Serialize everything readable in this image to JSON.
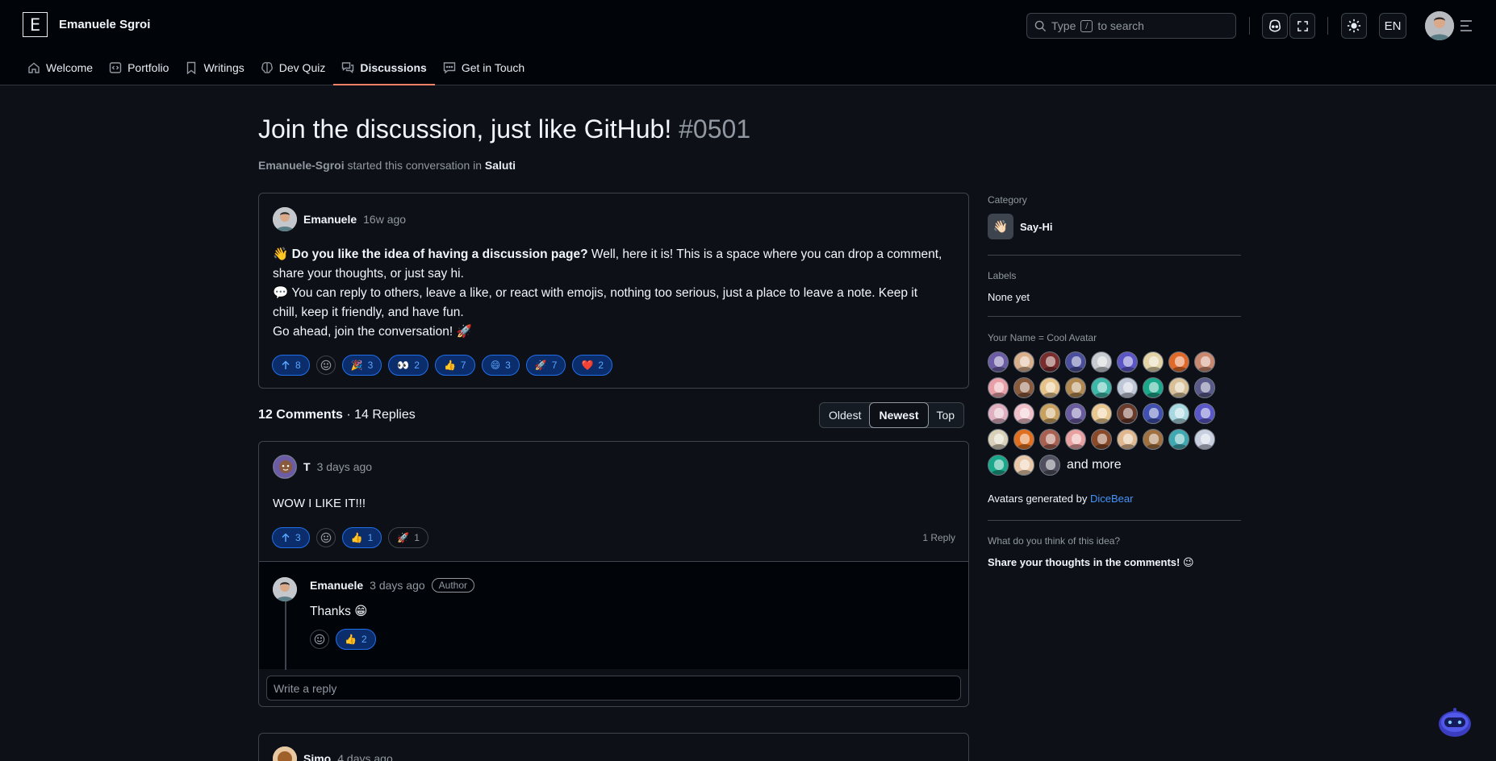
{
  "header": {
    "logo_letter": "E",
    "brand": "Emanuele Sgroi",
    "search": {
      "prefix": "Type",
      "key": "/",
      "suffix": "to search"
    },
    "lang": "EN"
  },
  "nav": {
    "items": [
      {
        "label": "Welcome",
        "icon": "home-icon"
      },
      {
        "label": "Portfolio",
        "icon": "code-icon"
      },
      {
        "label": "Writings",
        "icon": "bookmark-icon"
      },
      {
        "label": "Dev Quiz",
        "icon": "brain-icon"
      },
      {
        "label": "Discussions",
        "icon": "comment-discussion-icon",
        "active": true
      },
      {
        "label": "Get in Touch",
        "icon": "message-icon"
      }
    ]
  },
  "discussion": {
    "title": "Join the discussion, just like GitHub!",
    "number": "#0501",
    "starter": "Emanuele-Sgroi",
    "started_text": "started this conversation in",
    "category_link": "Saluti"
  },
  "post": {
    "author": "Emanuele",
    "time": "16w ago",
    "line1_emoji": "👋",
    "line1_bold": "Do you like the idea of having a discussion page?",
    "line1_rest": "Well, here it is! This is a space where you can drop a comment,",
    "line2": "share your thoughts, or just say hi.",
    "line3": "💬 You can reply to others, leave a like, or react with emojis, nothing too serious, just a place to leave a note. Keep it",
    "line4": "chill, keep it friendly, and have fun.",
    "line5": "Go ahead, join the conversation! 🚀",
    "upvotes": "8",
    "reactions": [
      {
        "emoji": "🎉",
        "count": "3"
      },
      {
        "emoji": "👀",
        "count": "2"
      },
      {
        "emoji": "👍",
        "count": "7"
      },
      {
        "emoji": "😄",
        "count": "3"
      },
      {
        "emoji": "🚀",
        "count": "7"
      },
      {
        "emoji": "❤️",
        "count": "2"
      }
    ]
  },
  "comments_bar": {
    "comments": "12 Comments",
    "dot": "·",
    "replies": "14 Replies",
    "sort": [
      "Oldest",
      "Newest",
      "Top"
    ],
    "active_sort": "Newest"
  },
  "comment1": {
    "author": "T",
    "time": "3 days ago",
    "body": "WOW I LIKE IT!!!",
    "upvotes": "3",
    "reactions": [
      {
        "emoji": "👍",
        "count": "1"
      },
      {
        "emoji": "🚀",
        "count": "1"
      }
    ],
    "reply_count": "1 Reply",
    "reply": {
      "author": "Emanuele",
      "time": "3 days ago",
      "badge": "Author",
      "body": "Thanks 😁",
      "reaction": {
        "emoji": "👍",
        "count": "2"
      }
    },
    "reply_placeholder": "Write a reply"
  },
  "comment2": {
    "author": "Simo",
    "time": "4 days ago"
  },
  "sidebar": {
    "category_label": "Category",
    "category_emoji": "👋🏻",
    "category_name": "Say-Hi",
    "labels_label": "Labels",
    "labels_value": "None yet",
    "avatars_label": "Your Name = Cool Avatar",
    "avatar_colors": [
      [
        "#6b5ca5",
        "#d9b08c",
        "#7a2d2d",
        "#4a4e9c",
        "#c8ccd0",
        "#5b55c6",
        "#e3d3a6",
        "#e0692a",
        "#c98870"
      ],
      [
        "#e8a0a8",
        "#8a5a3c",
        "#e6c38a",
        "#b08850",
        "#3db8a8",
        "#c0c8d8",
        "#1aa88a",
        "#d8c098",
        "#5a5a8a"
      ],
      [
        "#e0b0c0",
        "#f0c0c8",
        "#c8a060",
        "#6a5aa0",
        "#e8c890",
        "#6a3a2a",
        "#4050b0",
        "#a8d8e0",
        "#5a58c8"
      ],
      [
        "#d8d0b8",
        "#e07020",
        "#a86050",
        "#e8a0a0",
        "#8a4a2a",
        "#e0b890",
        "#a07040",
        "#40a8b0",
        "#c8d0e0"
      ],
      [
        "#1aa88a",
        "#e8c8a8",
        "#505060"
      ]
    ],
    "and_more": "and more",
    "generated_prefix": "Avatars generated by",
    "generated_link": "DiceBear",
    "idea_label": "What do you think of this idea?",
    "idea_text": "Share your thoughts in the comments! 😉"
  }
}
